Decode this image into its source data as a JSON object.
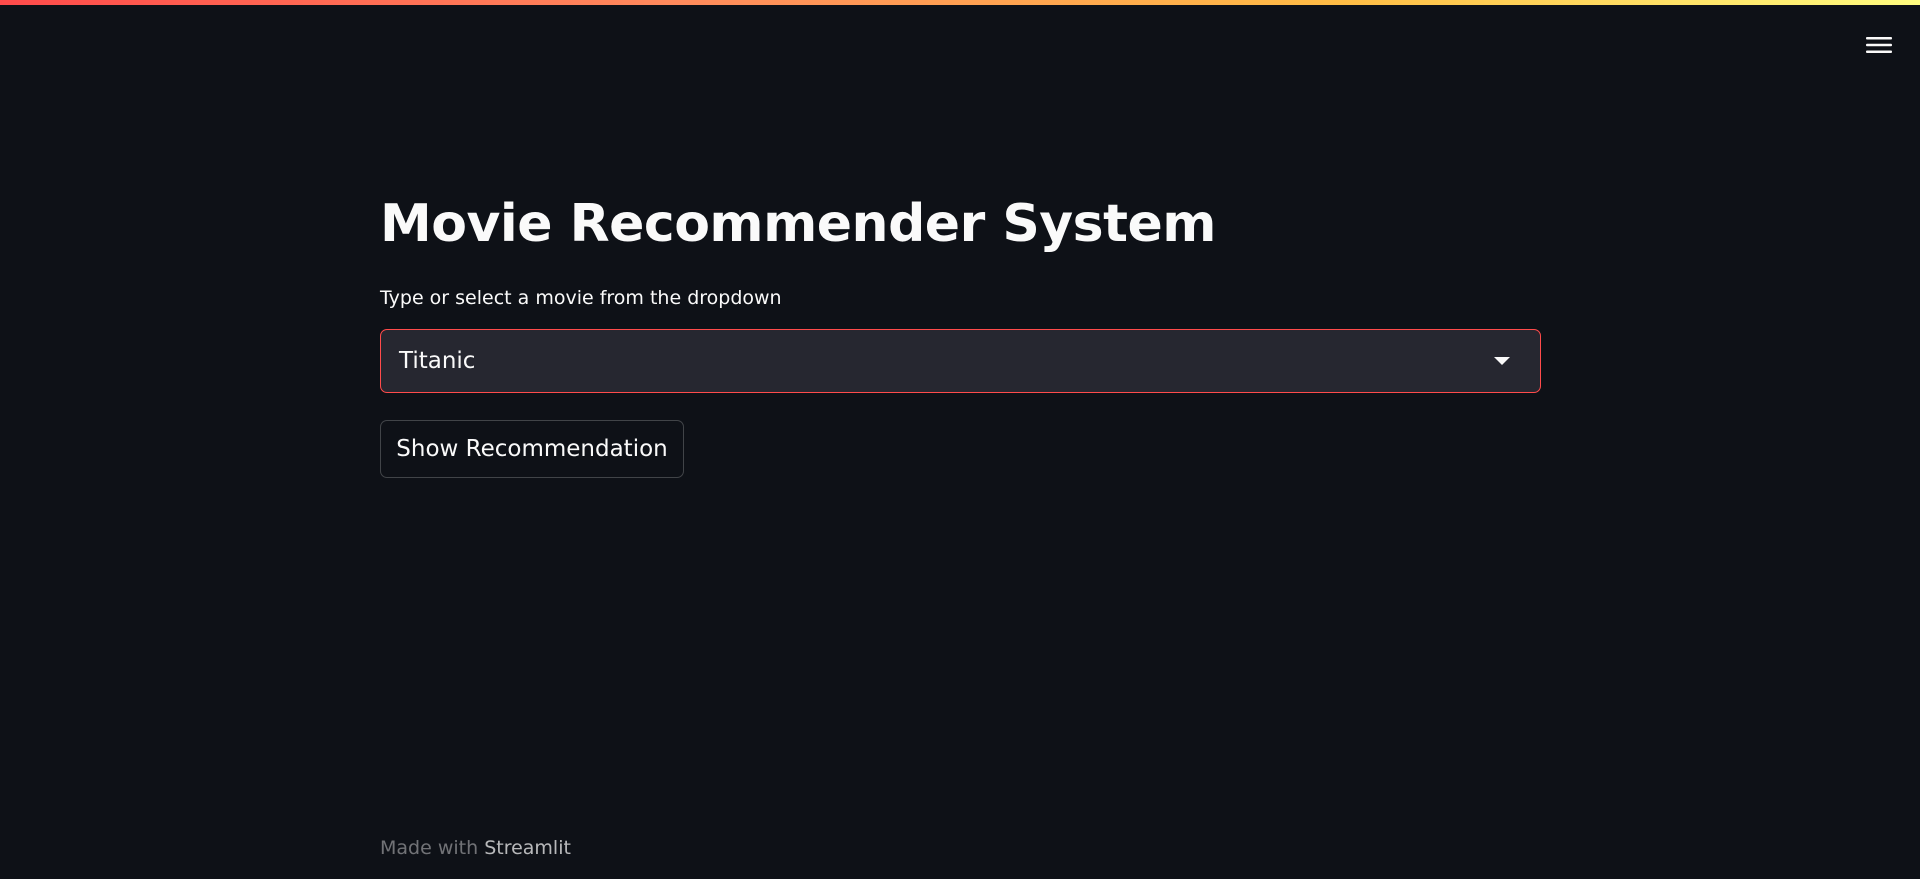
{
  "app": {
    "accent_color": "#ff4b4b",
    "background_color": "#0e1117",
    "input_background_color": "#262730"
  },
  "header": {
    "menu_icon": "hamburger-menu-icon"
  },
  "main": {
    "title": "Movie Recommender System",
    "select": {
      "label": "Type or select a movie from the dropdown",
      "value": "Titanic",
      "arrow_icon": "caret-down-icon"
    },
    "button_label": "Show Recommendation"
  },
  "footer": {
    "made_with": "Made with ",
    "brand": "Streamlit"
  }
}
